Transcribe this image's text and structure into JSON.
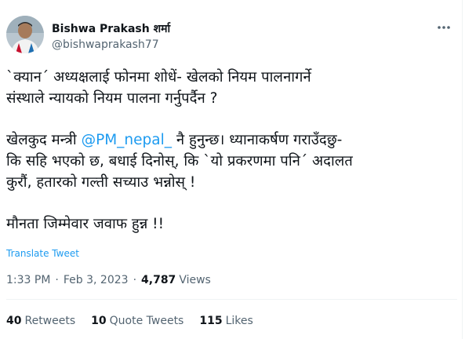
{
  "author": {
    "display_name": "Bishwa Prakash शर्मा",
    "handle": "@bishwaprakash77"
  },
  "tweet": {
    "para1": "`क्यान´ अध्यक्षलाई फोनमा शोधें- खेलको नियम पालनागर्ने\nसंस्थाले न्यायको नियम पालना गर्नुपर्दैन ?",
    "para2_before": "खेलकुद मन्त्री ",
    "para2_mention": "@PM_nepal_",
    "para2_after": " नै हुनुन्छ। ध्यानाकर्षण गराउँदछु-\nकि सहि भएको छ, बधाई दिनोस्, कि `यो प्रकरणमा पनि´ अदालत\nकुरौं, हतारको गल्ती सच्याउ भन्नोस् !",
    "para3": "मौनता जिम्मेवार जवाफ हुन्न !!"
  },
  "translate_label": "Translate Tweet",
  "meta": {
    "time": "1:33 PM",
    "dot1": "·",
    "date": "Feb 3, 2023",
    "dot2": "·",
    "views_count": "4,787",
    "views_label": "Views"
  },
  "stats": {
    "retweets_count": "40",
    "retweets_label": "Retweets",
    "quotes_count": "10",
    "quotes_label": "Quote Tweets",
    "likes_count": "115",
    "likes_label": "Likes"
  },
  "icons": {
    "more": "more-horizontal-icon",
    "avatar": "avatar"
  },
  "colors": {
    "link": "#1d9bf0",
    "secondary_text": "#536471",
    "primary_text": "#0f1419",
    "divider": "#eff3f4"
  }
}
